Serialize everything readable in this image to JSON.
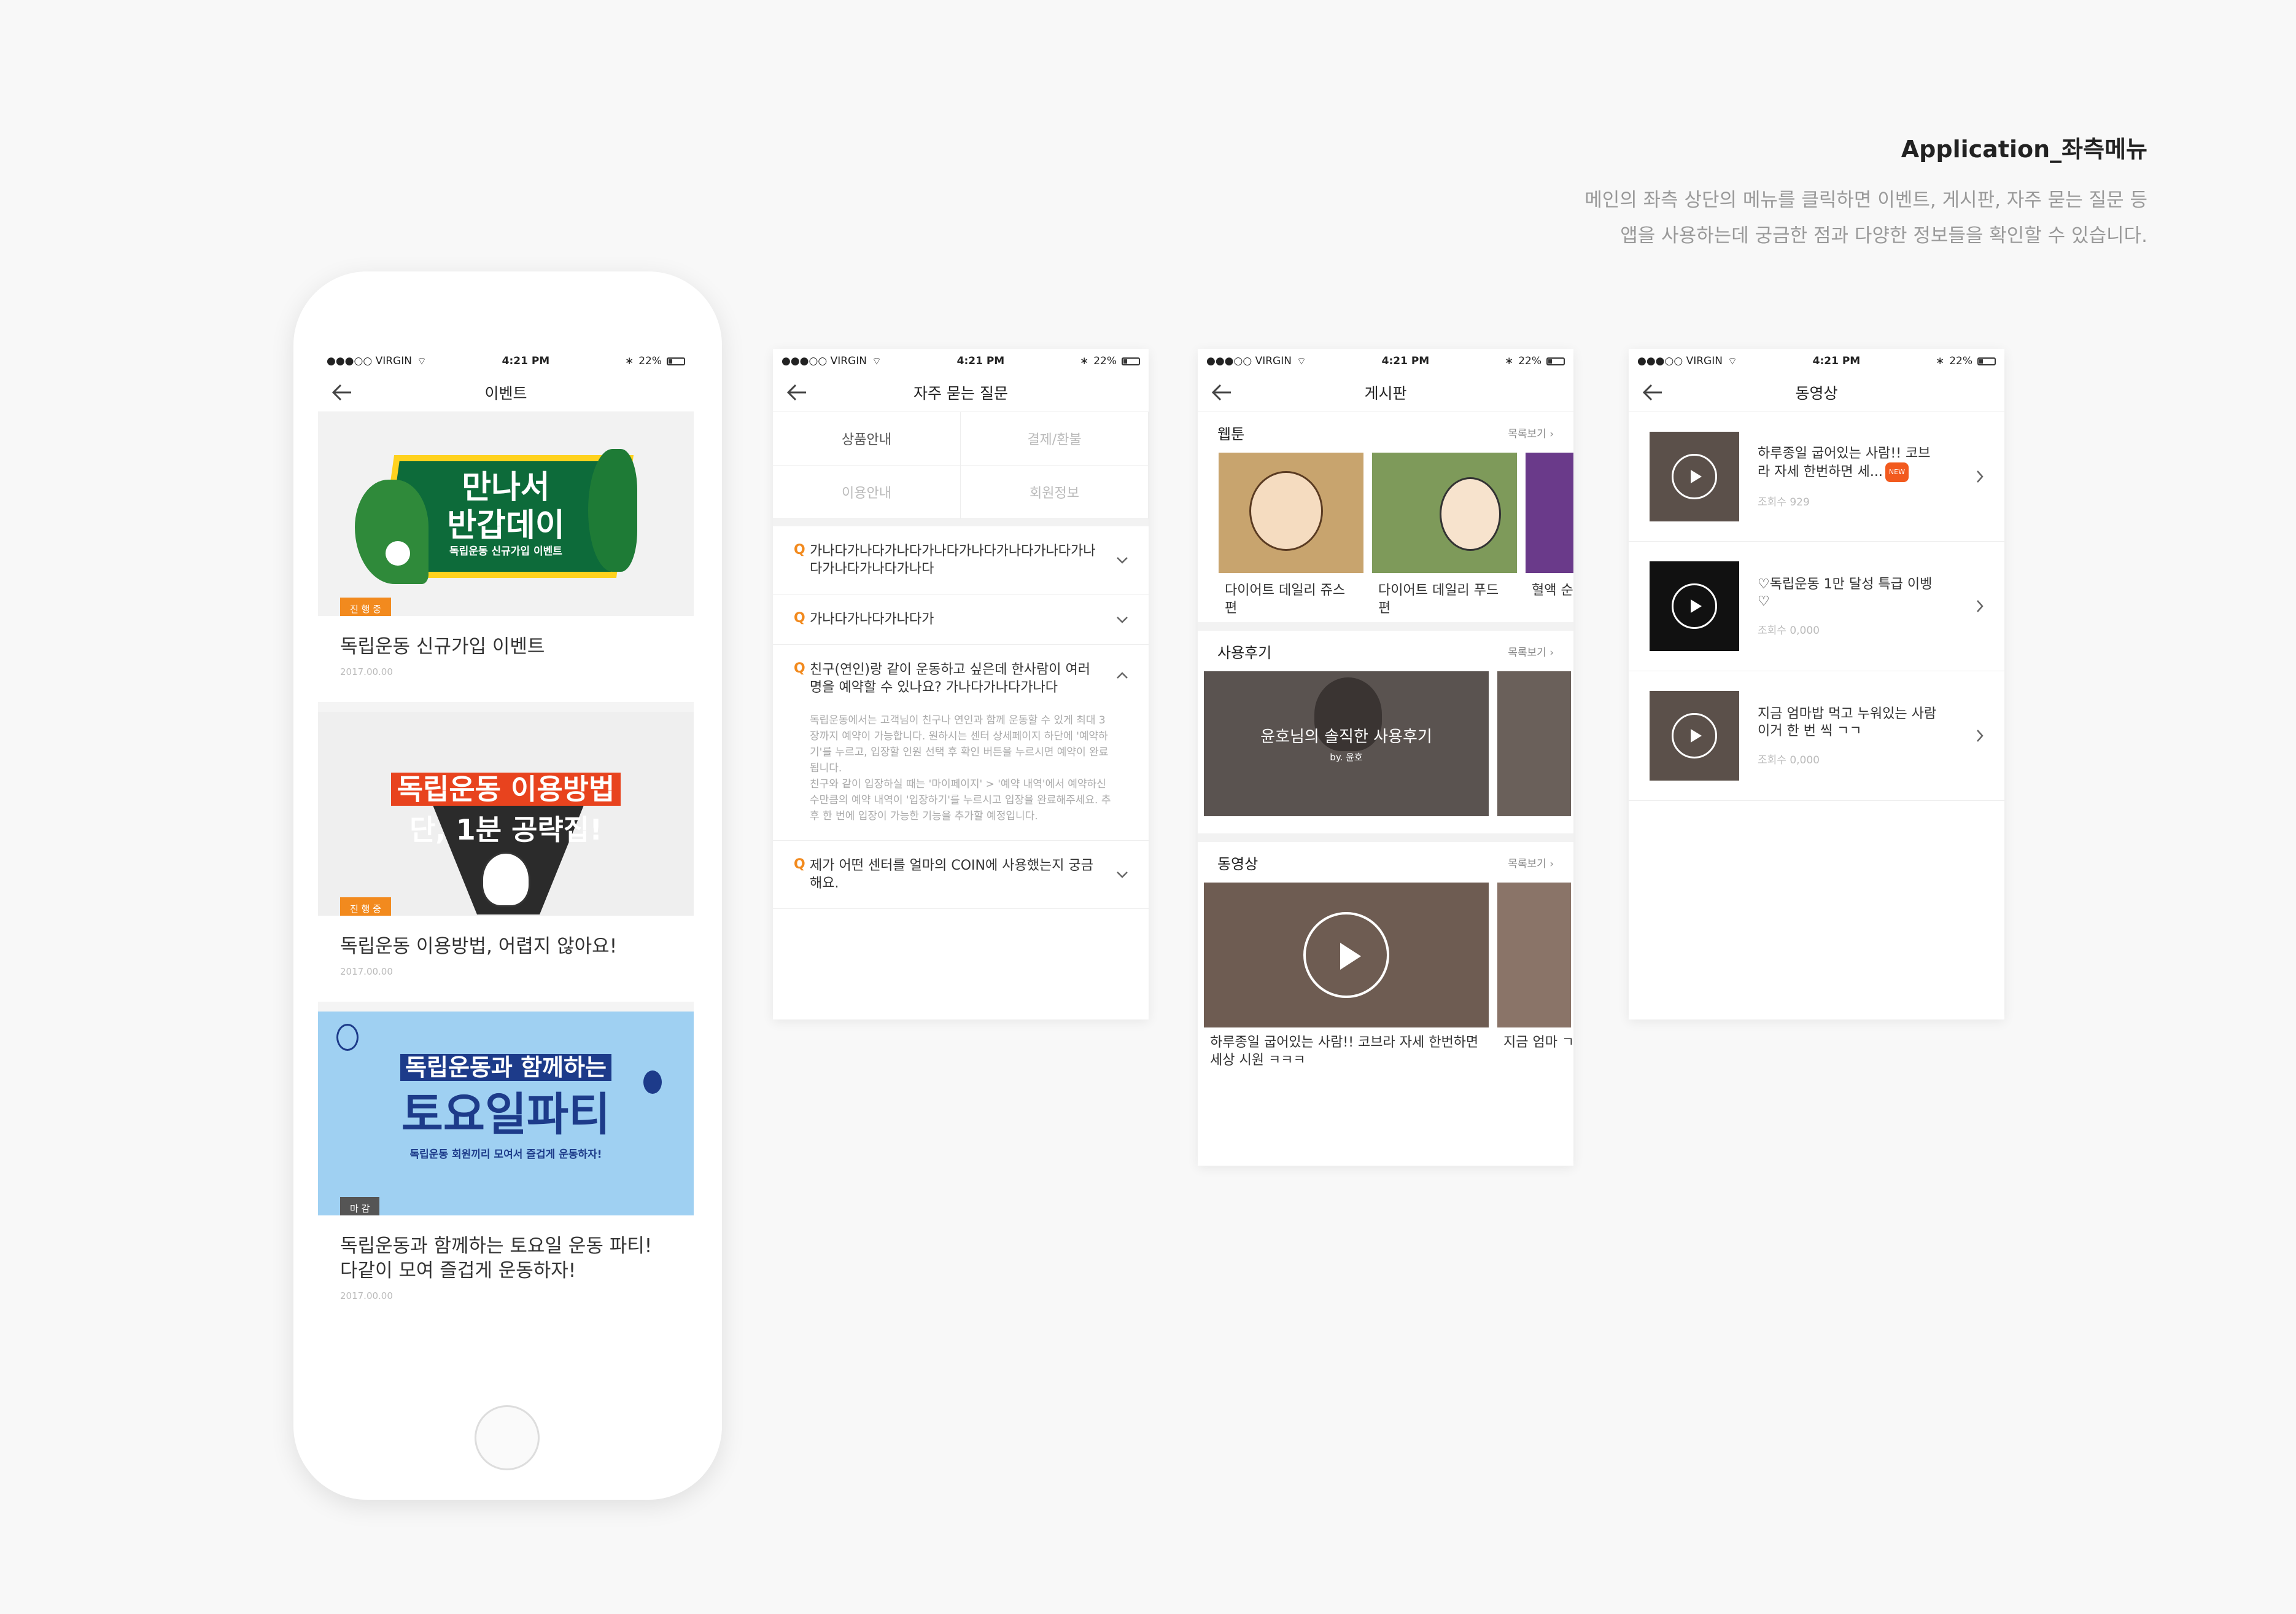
{
  "header": {
    "title": "Application_좌측메뉴",
    "desc_line1": "메인의 좌측 상단의 메뉴를 클릭하면 이벤트, 게시판, 자주 묻는 질문 등",
    "desc_line2": "앱을 사용하는데 궁금한 점과 다양한 정보들을 확인할 수 있습니다."
  },
  "status": {
    "carrier": "●●●○○ VIRGIN",
    "time": "4:21 PM",
    "battery": "22%"
  },
  "events": {
    "title": "이벤트",
    "items": [
      {
        "banner_line1": "만나서",
        "banner_line2": "반갑데이",
        "banner_sub": "독립운동 신규가입 이벤트",
        "badge": "진 행 중",
        "title": "독립운동 신규가입 이벤트",
        "date": "2017.00.00"
      },
      {
        "banner_line1": "독립운동 이용방법",
        "banner_line2": "단, 1분 공략집!",
        "badge": "진 행 중",
        "title": "독립운동 이용방법, 어렵지 않아요!",
        "date": "2017.00.00"
      },
      {
        "banner_line1": "독립운동과 함께하는",
        "banner_line2": "토요일파티",
        "banner_sub": "독립운동 회원끼리 모여서 즐겁게 운동하자!",
        "badge": "마 감",
        "title_line1": "독립운동과 함께하는 토요일 운동 파티!",
        "title_line2": "다같이 모여 즐겁게 운동하자!",
        "date": "2017.00.00"
      }
    ]
  },
  "faq": {
    "title": "자주 묻는 질문",
    "tabs": [
      "상품안내",
      "결제/환불",
      "이용안내",
      "회원정보"
    ],
    "q_mark": "Q",
    "items": [
      {
        "text": "가나다가나다가나다가나다가나다가나다가나다가나다가나다가나다가나다"
      },
      {
        "text": "가나다가나다가나다가"
      },
      {
        "text": "친구(연인)랑 같이 운동하고 싶은데 한사람이 여러 명을 예약할 수 있나요? 가나다가나다가나다",
        "answer_p1": "독립운동에서는 고객님이 친구나 연인과 함께 운동할 수 있게 최대 3장까지 예약이 가능합니다. 원하시는 센터 상세페이지 하단에 '예약하기'를 누르고, 입장할 인원 선택 후 확인 버튼을 누르시면 예약이 완료됩니다.",
        "answer_p2": "친구와 같이 입장하실 때는 '마이페이지' > '예약 내역'에서 예약하신 수만큼의 예약 내역이 '입장하기'를 누르시고 입장을 완료해주세요. 추후 한 번에 입장이 가능한 기능을 추가할 예정입니다."
      },
      {
        "text": "제가 어떤 센터를 얼마의 COIN에 사용했는지 궁금해요."
      }
    ]
  },
  "board": {
    "title": "게시판",
    "more": "목록보기 ›",
    "webtoon": {
      "label": "웹툰",
      "items": [
        "다이어트 데일리 쥬스 편",
        "다이어트 데일리 푸드 편",
        "혈액 순"
      ]
    },
    "review": {
      "label": "사용후기",
      "title": "윤호님의 솔직한 사용후기",
      "by": "by. 윤호"
    },
    "video": {
      "label": "동영상",
      "caption": "하루종일 굽어있는 사람!! 코브라 자세 한번하면 세상 시원 ㅋㅋㅋ",
      "caption2": "지금 엄마 ㄱㄱ"
    }
  },
  "videos": {
    "title": "동영상",
    "new_label": "NEW",
    "items": [
      {
        "title": "하루종일 굽어있는 사람!! 코브라 자세 한번하면 세...",
        "views": "조회수 929",
        "is_new": true
      },
      {
        "title": "♡독립운동 1만 달성 특급 이벵♡",
        "views": "조회수 0,000"
      },
      {
        "title": "지금 엄마밥 먹고 누워있는 사람 이거 한 번 씩 ㄱㄱ",
        "views": "조회수 0,000"
      }
    ]
  },
  "colors": {
    "accent": "#f28a1e",
    "new_badge": "#f25a1e",
    "closed_badge": "#555555"
  }
}
